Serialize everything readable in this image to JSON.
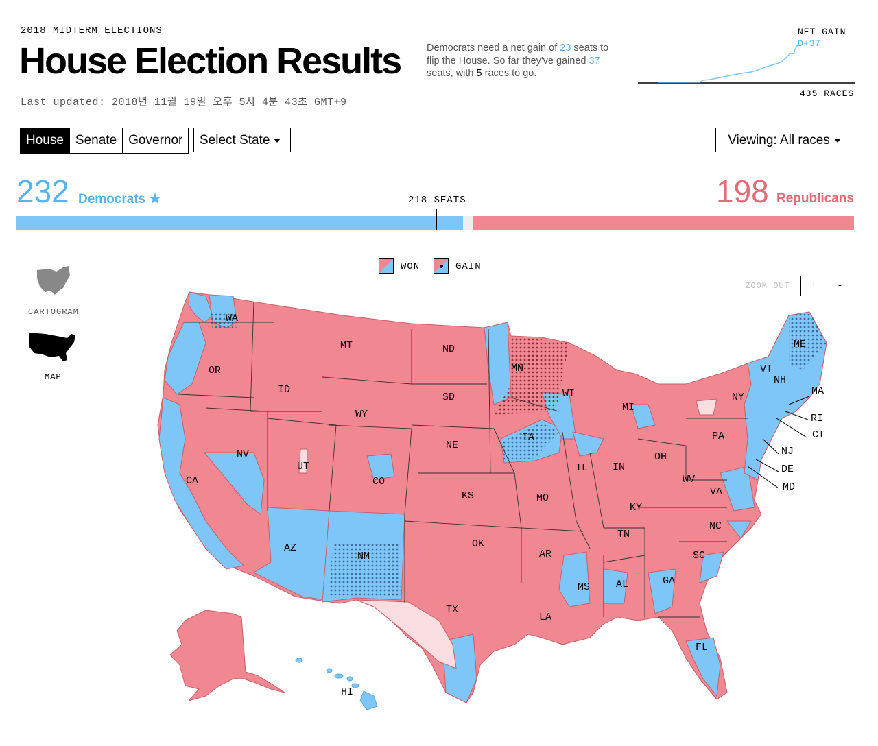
{
  "header": {
    "kicker": "2018 MIDTERM ELECTIONS",
    "title": "House Election Results",
    "last_updated": "Last updated: 2018년 11월 19일 오후 5시 4분 43초 GMT+9"
  },
  "summary": {
    "line1a": "Democrats need a net gain of ",
    "needed": "23",
    "line1b": " seats to flip the House. So far they've gained ",
    "gained": "37",
    "line2": " seats, with ",
    "remaining": "5",
    "line3": " races to go."
  },
  "net_gain": {
    "label": "NET GAIN",
    "value": "D+37",
    "races_label": "435 RACES"
  },
  "tabs": [
    {
      "label": "House",
      "active": true
    },
    {
      "label": "Senate",
      "active": false
    },
    {
      "label": "Governor",
      "active": false
    }
  ],
  "select_state": "Select State",
  "viewing": "Viewing: All races",
  "tally": {
    "dem_count": "232",
    "dem_label": "Democrats ★",
    "rep_count": "198",
    "rep_label": "Republicans",
    "majority_label": "218 SEATS",
    "dem_seats": 232,
    "rep_seats": 198,
    "total_seats": 435,
    "majority": 218
  },
  "legend": {
    "won": "WON",
    "gain": "GAIN"
  },
  "zoom": {
    "out": "ZOOM OUT",
    "in_symbol": "+",
    "out_symbol": "-"
  },
  "views": {
    "cartogram": "CARTOGRAM",
    "map": "MAP"
  },
  "colors": {
    "dem": "#7dc6f7",
    "rep": "#f08791",
    "pending": "#f9dde0",
    "dem_text": "#57b4f0",
    "rep_text": "#e56b77"
  },
  "states": [
    "WA",
    "OR",
    "CA",
    "ID",
    "NV",
    "MT",
    "WY",
    "UT",
    "AZ",
    "CO",
    "NM",
    "ND",
    "SD",
    "NE",
    "KS",
    "OK",
    "TX",
    "MN",
    "IA",
    "MO",
    "AR",
    "LA",
    "WI",
    "IL",
    "MS",
    "MI",
    "IN",
    "TN",
    "AL",
    "KY",
    "OH",
    "GA",
    "FL",
    "SC",
    "NC",
    "WV",
    "VA",
    "PA",
    "NY",
    "VT",
    "NH",
    "ME",
    "AK",
    "HI"
  ],
  "east_labels": [
    "MA",
    "RI",
    "CT",
    "NJ",
    "DE",
    "MD"
  ]
}
